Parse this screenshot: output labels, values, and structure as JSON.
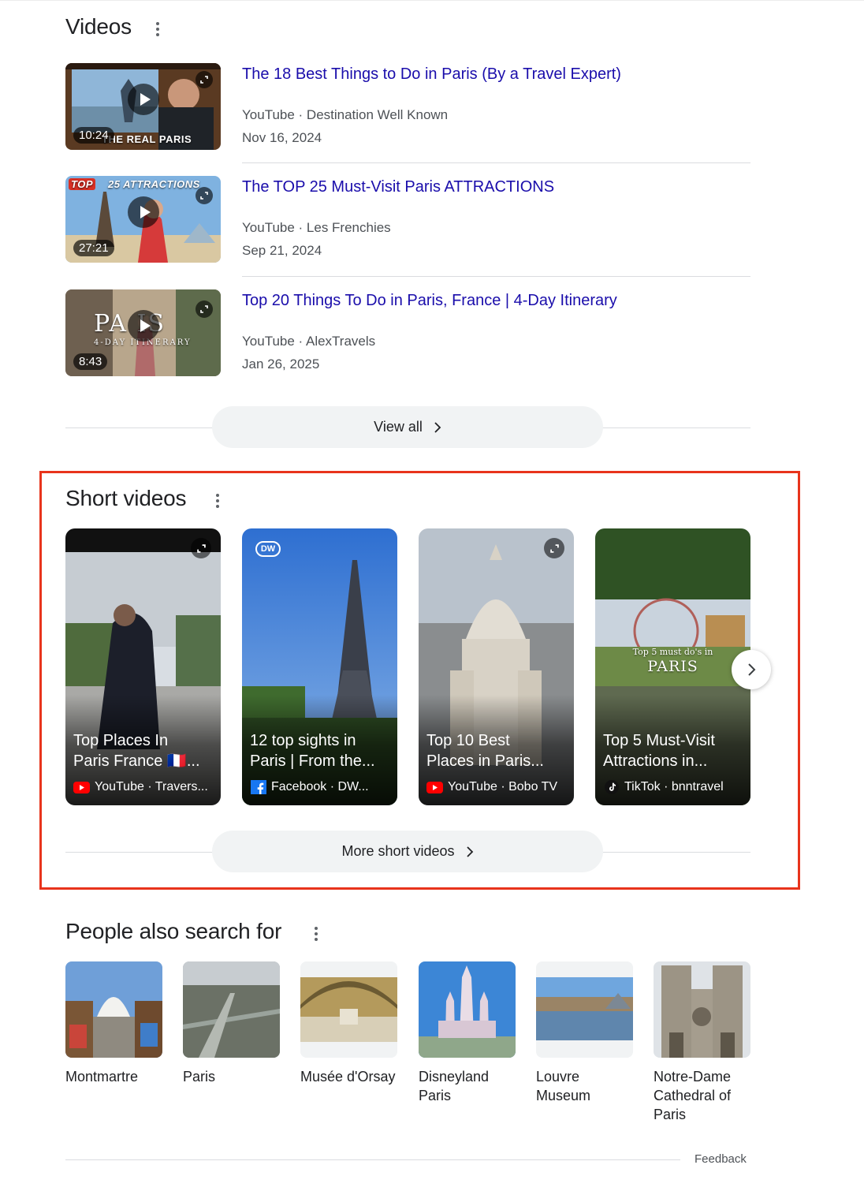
{
  "videos_section": {
    "title": "Videos",
    "items": [
      {
        "title": "The 18 Best Things to Do in Paris (By a Travel Expert)",
        "meta": "YouTube · Destination Well Known",
        "date": "Nov 16, 2024",
        "duration": "10:24",
        "thumb_text": "THE REAL PARIS"
      },
      {
        "title": "The TOP 25 Must-Visit Paris ATTRACTIONS",
        "meta": "YouTube · Les Frenchies",
        "date": "Sep 21, 2024",
        "duration": "27:21",
        "thumb_text_badge": "TOP",
        "thumb_text": "25 ATTRACTIONS"
      },
      {
        "title": "Top 20 Things To Do in Paris, France | 4-Day Itinerary",
        "meta": "YouTube · AlexTravels",
        "date": "Jan 26, 2025",
        "duration": "8:43",
        "thumb_text": "PA  IS",
        "thumb_subtext": "4-DAY ITINERARY"
      }
    ],
    "view_all_label": "View all"
  },
  "short_videos_section": {
    "title": "Short videos",
    "items": [
      {
        "title_line1": "Top Places In",
        "title_line2": "Paris France 🇫🇷...",
        "source": "YouTube · Travers...",
        "platform": "youtube"
      },
      {
        "title_line1": "12 top sights in",
        "title_line2": "Paris | From the...",
        "source": "Facebook · DW...",
        "platform": "facebook",
        "badge": "DW"
      },
      {
        "title_line1": "Top 10 Best",
        "title_line2": "Places in Paris...",
        "source": "YouTube · Bobo TV",
        "platform": "youtube"
      },
      {
        "title_line1": "Top 5 Must-Visit",
        "title_line2": "Attractions in...",
        "source": "TikTok · bnntravel",
        "platform": "tiktok",
        "overlay_line1": "Top 5 must do's in",
        "overlay_line2": "PARIS"
      }
    ],
    "more_label": "More short videos"
  },
  "people_also_search": {
    "title": "People also search for",
    "items": [
      {
        "label": "Montmartre"
      },
      {
        "label": "Paris"
      },
      {
        "label": "Musée d'Orsay"
      },
      {
        "label": "Disneyland Paris"
      },
      {
        "label": "Louvre Museum"
      },
      {
        "label": "Notre-Dame Cathedral of Paris"
      }
    ]
  },
  "footer": {
    "feedback_label": "Feedback"
  },
  "colors": {
    "link": "#1a0dab",
    "meta_text": "#4d5156",
    "pill_bg": "#f1f3f4",
    "highlight_border": "#e8341c",
    "youtube_red": "#ff0000",
    "facebook_blue": "#1877f2"
  },
  "icons": [
    "more-vert-icon",
    "play-icon",
    "expand-icon",
    "chevron-right-icon",
    "youtube-icon",
    "facebook-icon",
    "tiktok-icon",
    "dw-logo-icon"
  ]
}
